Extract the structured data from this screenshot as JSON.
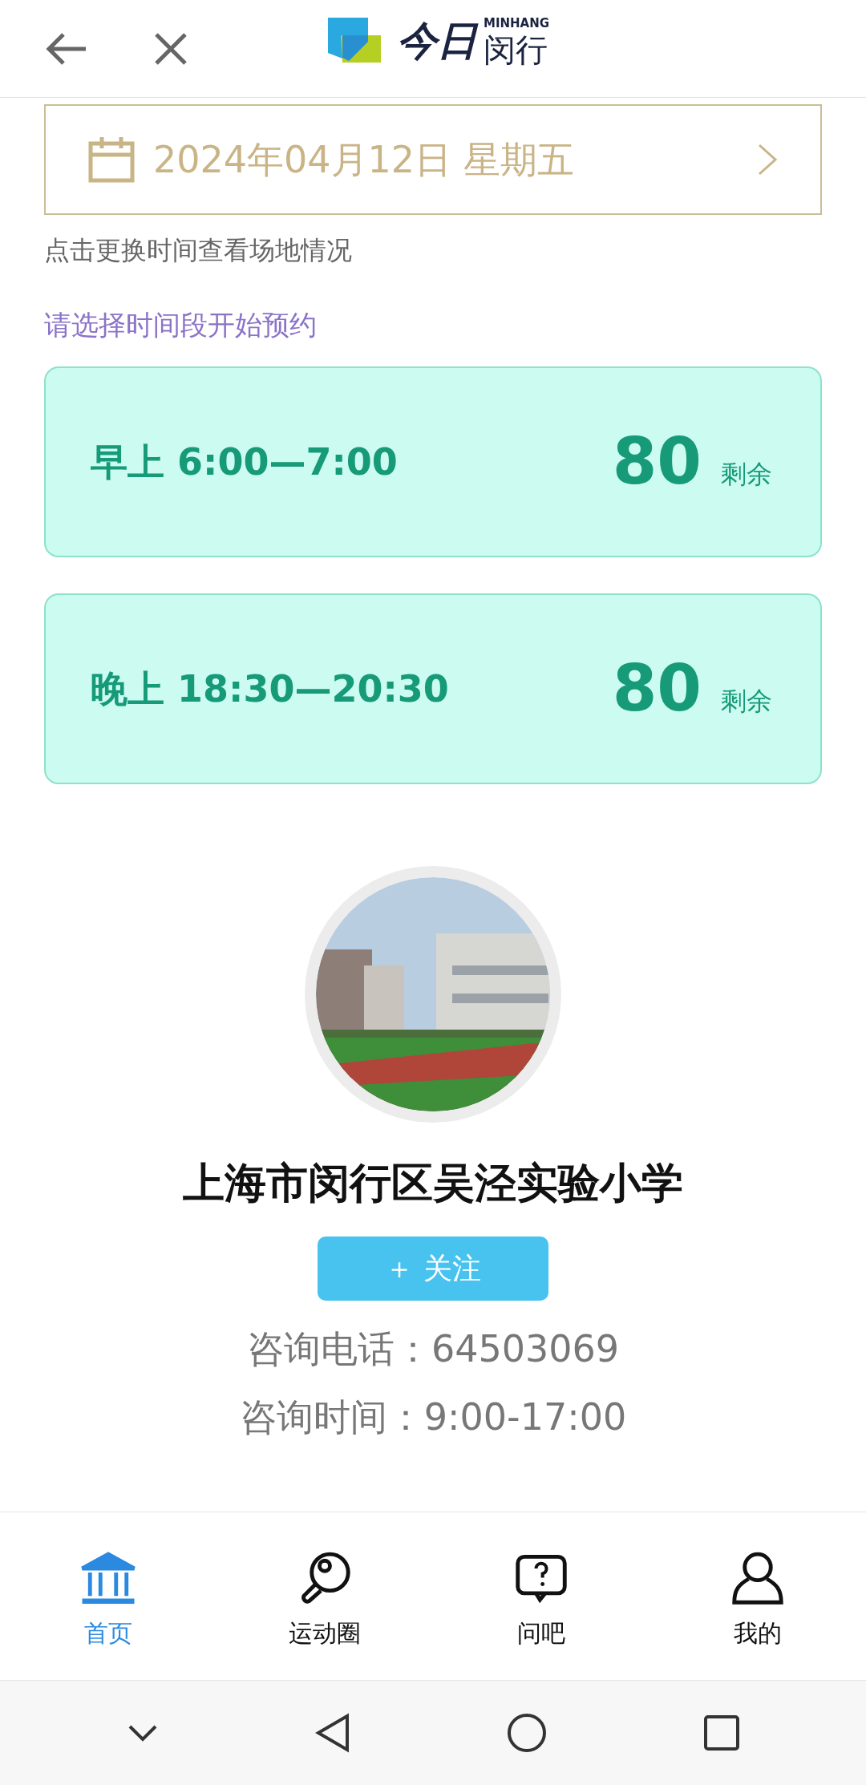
{
  "header": {
    "logo_script": "今日",
    "logo_latin": "MINHANG",
    "logo_name": "闵行"
  },
  "date_picker": {
    "date": "2024年04月12日 星期五"
  },
  "date_hint": "点击更换时间查看场地情况",
  "slots_prompt": "请选择时间段开始预约",
  "slots": [
    {
      "label": "早上 6:00—7:00",
      "remaining": "80",
      "remaining_label": "剩余"
    },
    {
      "label": "晚上 18:30—20:30",
      "remaining": "80",
      "remaining_label": "剩余"
    }
  ],
  "venue": {
    "name": "上海市闵行区吴泾实验小学",
    "follow_button": "＋ 关注",
    "phone": "咨询电话：64503069",
    "hours": "咨询时间：9:00-17:00"
  },
  "tab_bar": [
    {
      "kind": "home",
      "label": "首页",
      "selected": true
    },
    {
      "kind": "sports",
      "label": "运动圈",
      "selected": false
    },
    {
      "kind": "ask",
      "label": "问吧",
      "selected": false
    },
    {
      "kind": "me",
      "label": "我的",
      "selected": false
    }
  ]
}
